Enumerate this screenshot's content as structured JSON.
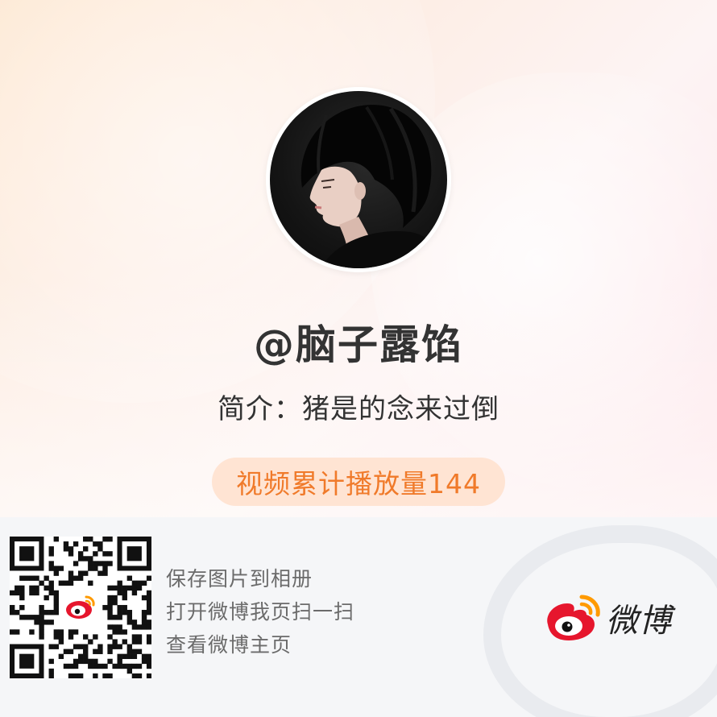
{
  "profile": {
    "username": "@脑子露馅",
    "bio": "简介：猪是的念来过倒",
    "views": "视频累计播放量144"
  },
  "footer": {
    "instructions": [
      "保存图片到相册",
      "打开微博我页扫一扫",
      "查看微博主页"
    ],
    "brand": "微博"
  },
  "colors": {
    "accent_orange": "#f07a2a",
    "pill_bg": "#ffe1cd",
    "weibo_red": "#e6162d",
    "weibo_orange": "#ff9a00"
  },
  "icons": {
    "qr_code": "qr-code-icon",
    "weibo_logo": "weibo-logo-icon"
  }
}
